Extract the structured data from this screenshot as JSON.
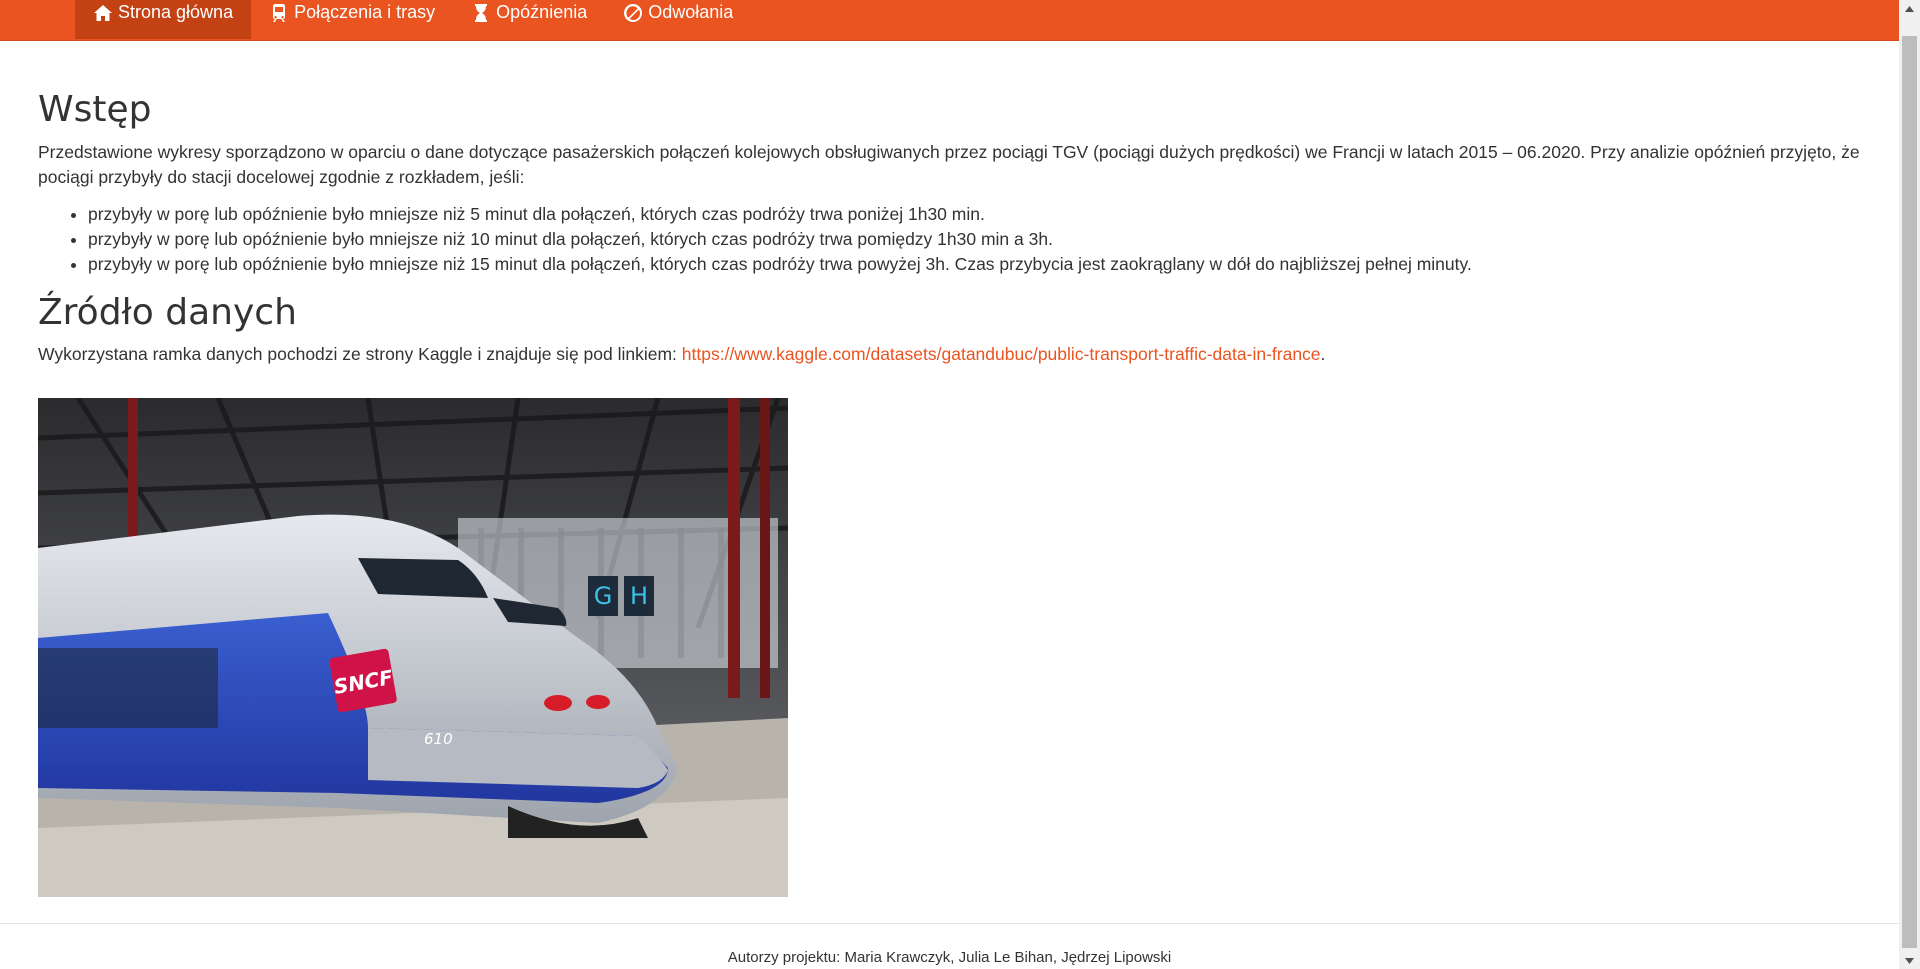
{
  "nav": {
    "items": [
      {
        "label": "Strona główna",
        "icon": "home-icon"
      },
      {
        "label": "Połączenia i trasy",
        "icon": "train-icon"
      },
      {
        "label": "Opóźnienia",
        "icon": "hourglass-icon"
      },
      {
        "label": "Odwołania",
        "icon": "ban-icon"
      }
    ],
    "active_index": 0
  },
  "intro": {
    "title": "Wstęp",
    "paragraph": "Przedstawione wykresy sporządzono w oparciu o dane dotyczące pasażerskich połączeń kolejowych obsługiwanych przez pociągi TGV (pociągi dużych prędkości) we Francji w latach 2015 – 06.2020. Przy analizie opóźnień przyjęto, że pociągi przybyły do stacji docelowej zgodnie z rozkładem, jeśli:",
    "rules": [
      "przybyły w porę lub opóźnienie było mniejsze niż 5 minut dla połączeń, których czas podróży trwa poniżej 1h30 min.",
      "przybyły w porę lub opóźnienie było mniejsze niż 10 minut dla połączeń, których czas podróży trwa pomiędzy 1h30 min a 3h.",
      "przybyły w porę lub opóźnienie było mniejsze niż 15 minut dla połączeń, których czas podróży trwa powyżej 3h. Czas przybycia jest zaokrąglany w dół do najbliższej pełnej minuty."
    ]
  },
  "source": {
    "title": "Źródło danych",
    "text": "Wykorzystana ramka danych pochodzi ze strony Kaggle i znajduje się pod linkiem: ",
    "link": "https://www.kaggle.com/datasets/gatandubuc/public-transport-traffic-data-in-france",
    "suffix": ".",
    "image": {
      "logo_text": "SNCF",
      "train_number": "610",
      "platform_signs": [
        "G",
        "H"
      ]
    }
  },
  "footer": {
    "text": "Autorzy projektu: Maria Krawczyk, Julia Le Bihan, Jędrzej Lipowski"
  },
  "colors": {
    "accent": "#e95420",
    "active_nav": "#c34113",
    "link": "#e95420",
    "text": "#333333"
  }
}
